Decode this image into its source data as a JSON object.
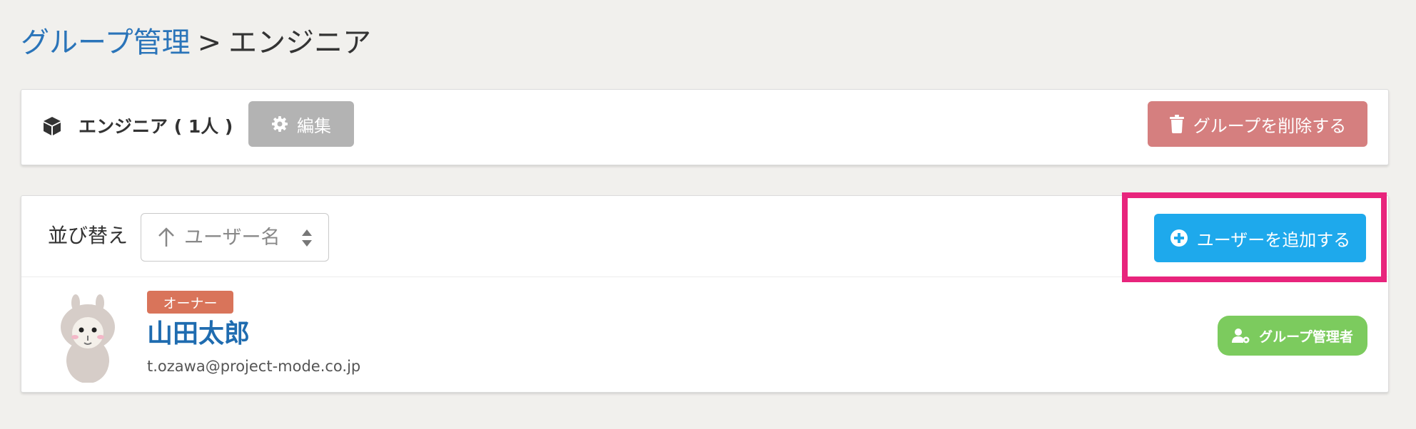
{
  "breadcrumb": {
    "parent": "グループ管理",
    "separator": ">",
    "current": "エンジニア"
  },
  "group": {
    "icon": "cube-icon",
    "name": "エンジニア ( 1人 )",
    "edit_label": "編集",
    "edit_icon": "gear-icon",
    "delete_label": "グループを削除する",
    "delete_icon": "trash-icon"
  },
  "members": {
    "sort_label": "並び替え",
    "sort_value": "ユーザー名",
    "add_user_label": "ユーザーを追加する",
    "add_user_icon": "plus-circle-icon",
    "users": [
      {
        "role_badge": "オーナー",
        "name": "山田太郎",
        "email": "t.ozawa@project-mode.co.jp",
        "admin_badge": "グループ管理者"
      }
    ]
  },
  "colors": {
    "link": "#2a74b9",
    "edit_button": "#b3b3b3",
    "delete_button": "#d57f7f",
    "add_button": "#1ea9ec",
    "highlight": "#e8247c",
    "owner_badge": "#d9745a",
    "admin_badge": "#7ccb5e"
  }
}
